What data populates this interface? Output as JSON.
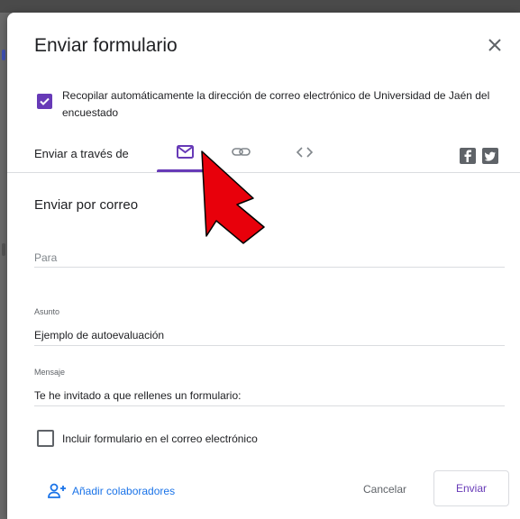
{
  "dialog": {
    "title": "Enviar formulario",
    "close_icon": "close-icon"
  },
  "collect_email": {
    "checked": true,
    "label": "Recopilar automáticamente la dirección de correo electrónico de Universidad de Jaén del encuestado"
  },
  "send_via": {
    "label": "Enviar a través de",
    "tabs": [
      {
        "icon": "email-icon",
        "active": true
      },
      {
        "icon": "link-icon",
        "active": false
      },
      {
        "icon": "embed-code-icon",
        "active": false
      }
    ],
    "social": [
      {
        "icon": "facebook-icon"
      },
      {
        "icon": "twitter-icon"
      }
    ]
  },
  "email_form": {
    "section_title": "Enviar por correo",
    "to": {
      "placeholder": "Para",
      "value": ""
    },
    "subject": {
      "label": "Asunto",
      "value": "Ejemplo de autoevaluación"
    },
    "message": {
      "label": "Mensaje",
      "value": "Te he invitado a que rellenes un formulario:"
    },
    "include_form": {
      "checked": false,
      "label": "Incluir formulario en el correo electrónico"
    }
  },
  "footer": {
    "add_collaborators": "Añadir colaboradores",
    "cancel": "Cancelar",
    "send": "Enviar"
  },
  "colors": {
    "accent": "#673ab7",
    "link": "#1a73e8",
    "annotation_arrow": "#e8000b"
  }
}
